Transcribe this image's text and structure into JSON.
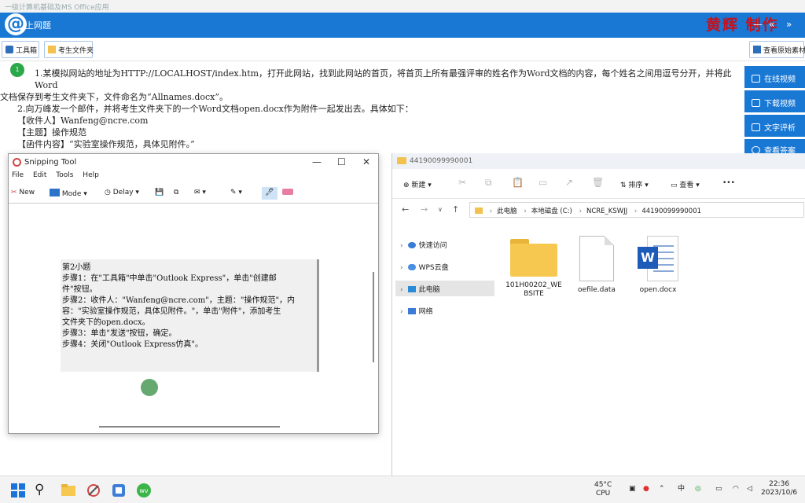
{
  "app": {
    "window_title": "一级计算机基础及MS Office应用",
    "bar_title": "上网题",
    "author": "黄辉 制作",
    "toolbox": "工具箱",
    "exam_folder": "考生文件夹",
    "view_source": "查看原始素材"
  },
  "question": {
    "line1": "1.某模拟网站的地址为HTTP://LOCALHOST/index.htm，打开此网站，找到此网站的首页，将首页上所有最强评审的姓名作为Word文档的内容，每个姓名之间用逗号分开，并将此Word",
    "line2": "文档保存到考生文件夹下，文件命名为“Allnames.docx”。",
    "line3": "2.向万峰发一个邮件，并将考生文件夹下的一个Word文档open.docx作为附件一起发出去。具体如下：",
    "line4": "【收件人】Wanfeng@ncre.com",
    "line5": "【主题】操作规范",
    "line6": "【函件内容】“实验室操作规范，具体见附件。”"
  },
  "side_buttons": [
    "在线视频",
    "下载视频",
    "文字评析",
    "查看答案"
  ],
  "snipping": {
    "title": "Snipping Tool",
    "menu": [
      "File",
      "Edit",
      "Tools",
      "Help"
    ],
    "new": "New",
    "mode": "Mode",
    "delay": "Delay",
    "note": [
      "第2小题",
      "步骤1：在\"工具箱\"中单击\"Outlook Express\"，单击\"创建邮",
      "件\"按钮。",
      "步骤2：收件人：\"Wanfeng@ncre.com\"，主题：\"操作规范\"，内",
      "容：\"实验室操作规范，具体见附件。\"，单击\"附件\"，添加考生",
      "文件夹下的open.docx。",
      "步骤3：单击\"发送\"按钮，确定。",
      "步骤4：关闭\"Outlook Express仿真\"。"
    ]
  },
  "explorer": {
    "title": "44190099990001",
    "new": "新建",
    "sort": "排序",
    "view": "查看",
    "path": [
      "此电脑",
      "本地磁盘 (C:)",
      "NCRE_KSWJJ",
      "44190099990001"
    ],
    "nav": [
      "快速访问",
      "WPS云盘",
      "此电脑",
      "网络"
    ],
    "files": [
      "101H00202_WEBSITE",
      "oefile.data",
      "open.docx"
    ]
  },
  "taskbar": {
    "weather_temp": "45°C",
    "weather_label": "CPU",
    "ime": "中",
    "time": "22:36",
    "date": "2023/10/6"
  },
  "colors": {
    "accent": "#1878d4",
    "author": "#c8101a",
    "folder": "#f6c84f",
    "word": "#1e5bb8"
  }
}
